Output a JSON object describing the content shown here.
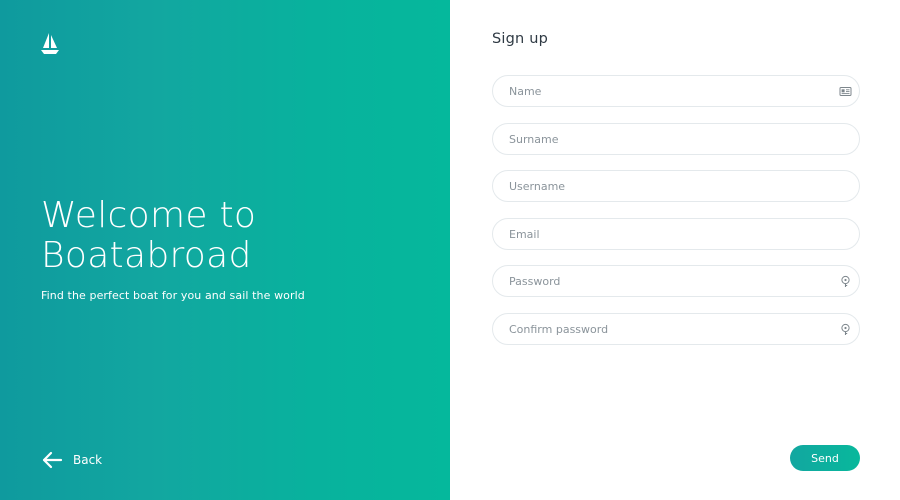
{
  "hero": {
    "logo_icon": "sailboat-icon",
    "title_line1": "Welcome to",
    "title_line2": "Boatabroad",
    "subtitle": "Find the perfect boat for you and sail the world",
    "back_label": "Back",
    "back_icon": "arrow-left-icon",
    "gradient": [
      "#0f9a9e",
      "#05b89c"
    ]
  },
  "form": {
    "title": "Sign up",
    "fields": [
      {
        "placeholder": "Name",
        "value": "",
        "icon": "id-card-icon"
      },
      {
        "placeholder": "Surname",
        "value": ""
      },
      {
        "placeholder": "Username",
        "value": ""
      },
      {
        "placeholder": "Email",
        "value": ""
      },
      {
        "placeholder": "Password",
        "value": "",
        "icon": "key-icon"
      },
      {
        "placeholder": "Confirm password",
        "value": "",
        "icon": "key-icon"
      }
    ],
    "send_label": "Send",
    "accent": "#12a7a0"
  }
}
